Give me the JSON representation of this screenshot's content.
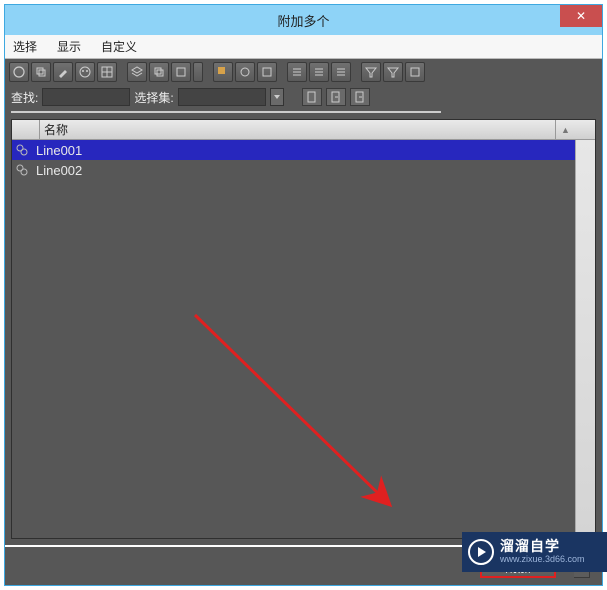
{
  "window": {
    "title": "附加多个",
    "close_icon": "✕"
  },
  "menu": {
    "select": "选择",
    "display": "显示",
    "custom": "自定义"
  },
  "search": {
    "find_label": "查找:",
    "select_label": "选择集:"
  },
  "list": {
    "header_name": "名称",
    "sort_indicator": "▲",
    "rows": [
      {
        "label": "Line001",
        "selected": true
      },
      {
        "label": "Line002",
        "selected": false
      }
    ]
  },
  "bottom": {
    "attach": "附加"
  },
  "watermark": {
    "line1": "溜溜自学",
    "line2": "www.zixue.3d66.com"
  }
}
